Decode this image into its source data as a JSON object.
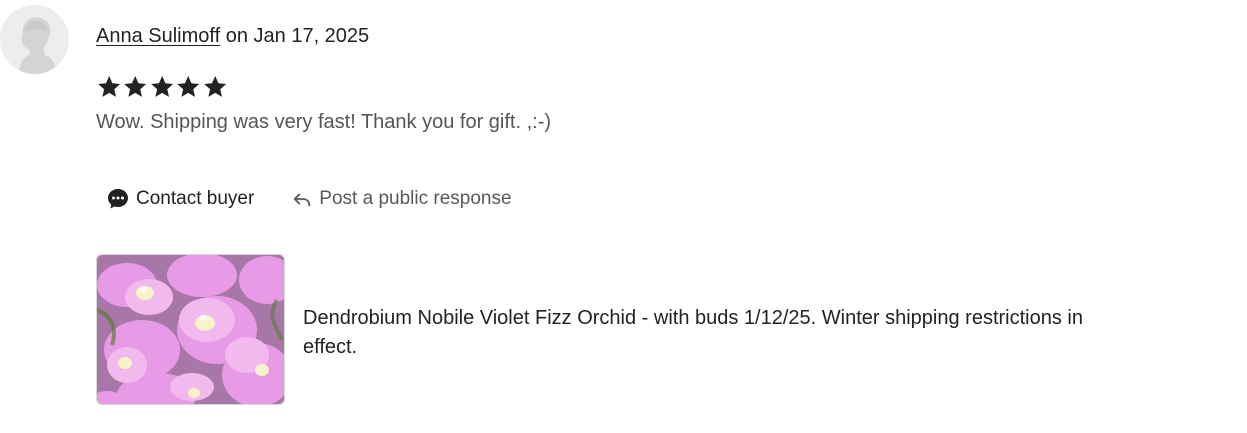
{
  "review": {
    "reviewer_name": "Anna Sulimoff",
    "date_text": " on Jan 17, 2025",
    "rating": 5,
    "rating_max": 5,
    "text": "Wow. Shipping was very fast! Thank you for gift. ,:-)",
    "star_color": "#222222"
  },
  "actions": {
    "contact_label": "Contact buyer",
    "respond_label": "Post a public response"
  },
  "product": {
    "title": "Dendrobium Nobile Violet Fizz Orchid - with buds 1/12/25. Winter shipping restrictions in effect.",
    "image_description_icon": "orchid-photo"
  }
}
